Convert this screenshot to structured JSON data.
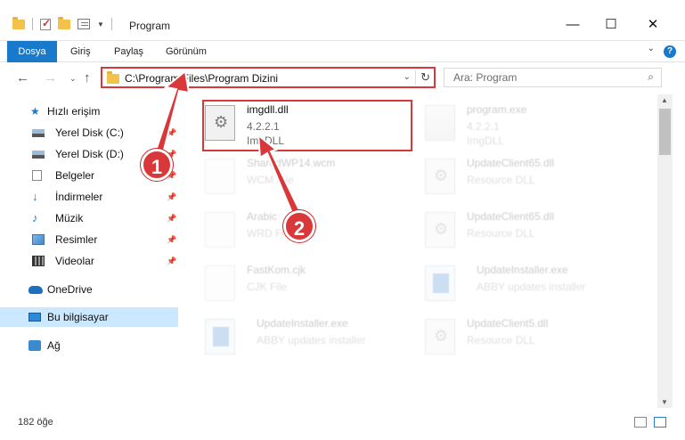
{
  "window": {
    "title": "Program",
    "min_symbol": "—",
    "max_symbol": "☐",
    "close_symbol": "✕"
  },
  "ribbon": {
    "tabs": [
      "Dosya",
      "Giriş",
      "Paylaş",
      "Görünüm"
    ],
    "help": "?"
  },
  "address": {
    "path": "C:\\Program Files\\Program Dizini",
    "search_placeholder": "Ara: Program"
  },
  "sidebar": {
    "quick_access": "Hızlı erişim",
    "items": [
      {
        "label": "Yerel Disk (C:)",
        "icon": "disk-icon",
        "pinned": true
      },
      {
        "label": "Yerel Disk (D:)",
        "icon": "disk-icon",
        "pinned": true
      },
      {
        "label": "Belgeler",
        "icon": "documents-icon",
        "pinned": true
      },
      {
        "label": "İndirmeler",
        "icon": "download-icon",
        "pinned": true
      },
      {
        "label": "Müzik",
        "icon": "music-icon",
        "pinned": true
      },
      {
        "label": "Resimler",
        "icon": "pictures-icon",
        "pinned": true
      },
      {
        "label": "Videolar",
        "icon": "videos-icon",
        "pinned": true
      }
    ],
    "onedrive": "OneDrive",
    "this_pc": "Bu bilgisayar",
    "network": "Ağ"
  },
  "files": [
    {
      "name": "imgdll.dll",
      "line2": "4.2.2.1",
      "line3": "ImgDLL",
      "icon": "dll-gear-icon"
    },
    {
      "name": "program.exe",
      "line2": "4.2.2.1",
      "line3": "ImgDLL",
      "icon": "exe-icon"
    },
    {
      "name": "SharedWP14.wcm",
      "line2": "WCM File",
      "line3": "",
      "icon": "page-icon"
    },
    {
      "name": "UpdateClient65.dll",
      "line2": "Resource DLL",
      "line3": "",
      "icon": "dll-gear-icon"
    },
    {
      "name": "Arabic",
      "line2": "WRD File",
      "line3": "",
      "icon": "page-icon"
    },
    {
      "name": "UpdateClient65.dll",
      "line2": "Resource DLL",
      "line3": "",
      "icon": "dll-gear-icon"
    },
    {
      "name": "FastKom.cjk",
      "line2": "CJK File",
      "line3": "",
      "icon": "page-icon"
    },
    {
      "name": "UpdateInstaller.exe",
      "line2": "ABBY updates installer",
      "line3": "",
      "icon": "installer-icon"
    },
    {
      "name": "UpdateInstaller.exe",
      "line2": "ABBY updates installer",
      "line3": "",
      "icon": "installer-icon"
    },
    {
      "name": "UpdateClient5.dll",
      "line2": "Resource DLL",
      "line3": "",
      "icon": "dll-gear-icon"
    }
  ],
  "status": {
    "count": "182 öğe"
  },
  "callouts": {
    "one": "1",
    "two": "2",
    "color": "#d9383a"
  }
}
